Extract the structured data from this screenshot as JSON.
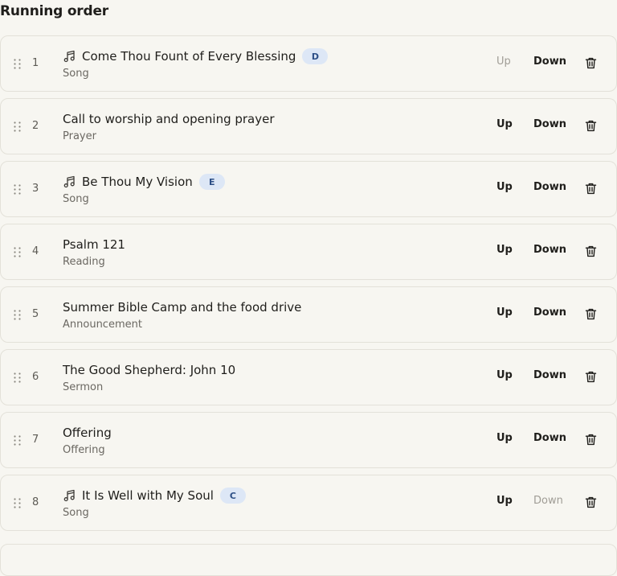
{
  "heading": "Running order",
  "items": [
    {
      "num": "1",
      "title": "Come Thou Fount of Every Blessing",
      "type": "Song",
      "song": true,
      "key": "D",
      "up": "Up",
      "down": "Down",
      "up_disabled": true,
      "down_disabled": false
    },
    {
      "num": "2",
      "title": "Call to worship and opening prayer",
      "type": "Prayer",
      "song": false,
      "key": "",
      "up": "Up",
      "down": "Down",
      "up_disabled": false,
      "down_disabled": false
    },
    {
      "num": "3",
      "title": "Be Thou My Vision",
      "type": "Song",
      "song": true,
      "key": "E",
      "up": "Up",
      "down": "Down",
      "up_disabled": false,
      "down_disabled": false
    },
    {
      "num": "4",
      "title": "Psalm 121",
      "type": "Reading",
      "song": false,
      "key": "",
      "up": "Up",
      "down": "Down",
      "up_disabled": false,
      "down_disabled": false
    },
    {
      "num": "5",
      "title": "Summer Bible Camp and the food drive",
      "type": "Announcement",
      "song": false,
      "key": "",
      "up": "Up",
      "down": "Down",
      "up_disabled": false,
      "down_disabled": false
    },
    {
      "num": "6",
      "title": "The Good Shepherd: John 10",
      "type": "Sermon",
      "song": false,
      "key": "",
      "up": "Up",
      "down": "Down",
      "up_disabled": false,
      "down_disabled": false
    },
    {
      "num": "7",
      "title": "Offering",
      "type": "Offering",
      "song": false,
      "key": "",
      "up": "Up",
      "down": "Down",
      "up_disabled": false,
      "down_disabled": false
    },
    {
      "num": "8",
      "title": "It Is Well with My Soul",
      "type": "Song",
      "song": true,
      "key": "C",
      "up": "Up",
      "down": "Down",
      "up_disabled": false,
      "down_disabled": true
    }
  ],
  "icons": {
    "grip": "drag-handle-icon",
    "music": "music-note-icon",
    "delete": "trash-icon"
  },
  "colors": {
    "background": "#f7f6f1",
    "badge_bg": "#dde7f6",
    "badge_text": "#2d4f86",
    "disabled": "#a09d96"
  }
}
